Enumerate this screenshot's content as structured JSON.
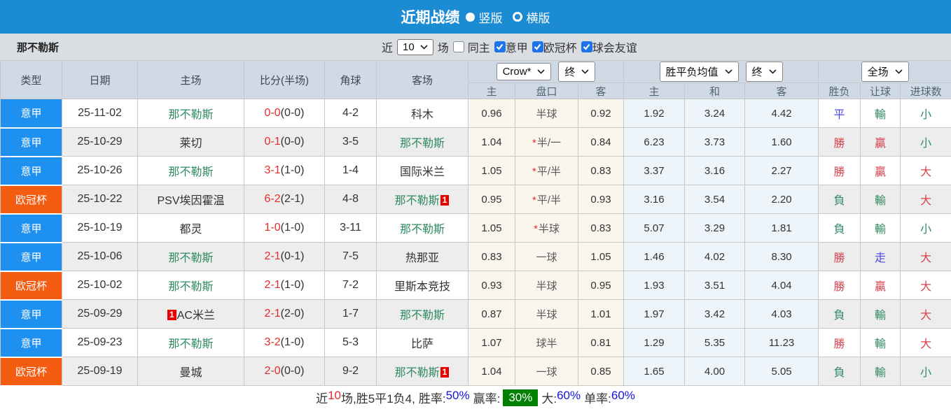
{
  "topbar": {
    "title": "近期战绩",
    "vertical_label": "竖版",
    "horizontal_label": "横版"
  },
  "filter": {
    "team": "那不勒斯",
    "near_label": "近",
    "count_value": "10",
    "games_label": "场",
    "same_home_label": "同主",
    "leagues": [
      "意甲",
      "欧冠杯",
      "球会友谊"
    ]
  },
  "table": {
    "left_headers": [
      "类型",
      "日期",
      "主场",
      "比分(半场)",
      "角球",
      "客场"
    ],
    "sub_headers": [
      "主",
      "盘口",
      "客",
      "主",
      "和",
      "客",
      "胜负",
      "让球",
      "进球数"
    ],
    "dropdowns": {
      "company": "Crow*",
      "time1": "终",
      "avg": "胜平负均值",
      "time2": "终",
      "scope": "全场"
    },
    "rows": [
      {
        "league": "意甲",
        "date": "25-11-02",
        "home": {
          "name": "那不勒斯",
          "subject": true
        },
        "away": {
          "name": "科木",
          "subject": false
        },
        "score": "0-0",
        "half": "(0-0)",
        "corners": "4-2",
        "odds": {
          "home": "0.96",
          "star": false,
          "handicap": "半球",
          "away": "0.92"
        },
        "avg": {
          "home": "1.92",
          "draw": "3.24",
          "away": "4.42"
        },
        "wdl": {
          "t": "平",
          "c": "draw"
        },
        "handicap": {
          "t": "輸",
          "c": "loss"
        },
        "goals": {
          "t": "小",
          "c": "loss"
        }
      },
      {
        "league": "意甲",
        "date": "25-10-29",
        "home": {
          "name": "莱切",
          "subject": false
        },
        "away": {
          "name": "那不勒斯",
          "subject": true
        },
        "score": "0-1",
        "half": "(0-0)",
        "corners": "3-5",
        "odds": {
          "home": "1.04",
          "star": true,
          "handicap": "半/一",
          "away": "0.84"
        },
        "avg": {
          "home": "6.23",
          "draw": "3.73",
          "away": "1.60"
        },
        "wdl": {
          "t": "勝",
          "c": "win"
        },
        "handicap": {
          "t": "贏",
          "c": "win"
        },
        "goals": {
          "t": "小",
          "c": "loss"
        }
      },
      {
        "league": "意甲",
        "date": "25-10-26",
        "home": {
          "name": "那不勒斯",
          "subject": true
        },
        "away": {
          "name": "国际米兰",
          "subject": false
        },
        "score": "3-1",
        "half": "(1-0)",
        "corners": "1-4",
        "odds": {
          "home": "1.05",
          "star": true,
          "handicap": "平/半",
          "away": "0.83"
        },
        "avg": {
          "home": "3.37",
          "draw": "3.16",
          "away": "2.27"
        },
        "wdl": {
          "t": "勝",
          "c": "win"
        },
        "handicap": {
          "t": "贏",
          "c": "win"
        },
        "goals": {
          "t": "大",
          "c": "win"
        }
      },
      {
        "league": "欧冠杯",
        "date": "25-10-22",
        "home": {
          "name": "PSV埃因霍温",
          "subject": false
        },
        "away": {
          "name": "那不勒斯",
          "subject": true,
          "card": "1",
          "card_pos": "after"
        },
        "score": "6-2",
        "half": "(2-1)",
        "corners": "4-8",
        "odds": {
          "home": "0.95",
          "star": true,
          "handicap": "平/半",
          "away": "0.93"
        },
        "avg": {
          "home": "3.16",
          "draw": "3.54",
          "away": "2.20"
        },
        "wdl": {
          "t": "負",
          "c": "loss"
        },
        "handicap": {
          "t": "輸",
          "c": "loss"
        },
        "goals": {
          "t": "大",
          "c": "win"
        }
      },
      {
        "league": "意甲",
        "date": "25-10-19",
        "home": {
          "name": "都灵",
          "subject": false
        },
        "away": {
          "name": "那不勒斯",
          "subject": true
        },
        "score": "1-0",
        "half": "(1-0)",
        "corners": "3-11",
        "odds": {
          "home": "1.05",
          "star": true,
          "handicap": "半球",
          "away": "0.83"
        },
        "avg": {
          "home": "5.07",
          "draw": "3.29",
          "away": "1.81"
        },
        "wdl": {
          "t": "負",
          "c": "loss"
        },
        "handicap": {
          "t": "輸",
          "c": "loss"
        },
        "goals": {
          "t": "小",
          "c": "loss"
        }
      },
      {
        "league": "意甲",
        "date": "25-10-06",
        "home": {
          "name": "那不勒斯",
          "subject": true
        },
        "away": {
          "name": "热那亚",
          "subject": false
        },
        "score": "2-1",
        "half": "(0-1)",
        "corners": "7-5",
        "odds": {
          "home": "0.83",
          "star": false,
          "handicap": "一球",
          "away": "1.05"
        },
        "avg": {
          "home": "1.46",
          "draw": "4.02",
          "away": "8.30"
        },
        "wdl": {
          "t": "勝",
          "c": "win"
        },
        "handicap": {
          "t": "走",
          "c": "draw"
        },
        "goals": {
          "t": "大",
          "c": "win"
        }
      },
      {
        "league": "欧冠杯",
        "date": "25-10-02",
        "home": {
          "name": "那不勒斯",
          "subject": true
        },
        "away": {
          "name": "里斯本竞技",
          "subject": false
        },
        "score": "2-1",
        "half": "(1-0)",
        "corners": "7-2",
        "odds": {
          "home": "0.93",
          "star": false,
          "handicap": "半球",
          "away": "0.95"
        },
        "avg": {
          "home": "1.93",
          "draw": "3.51",
          "away": "4.04"
        },
        "wdl": {
          "t": "勝",
          "c": "win"
        },
        "handicap": {
          "t": "贏",
          "c": "win"
        },
        "goals": {
          "t": "大",
          "c": "win"
        }
      },
      {
        "league": "意甲",
        "date": "25-09-29",
        "home": {
          "name": "AC米兰",
          "subject": false,
          "card": "1",
          "card_pos": "before"
        },
        "away": {
          "name": "那不勒斯",
          "subject": true
        },
        "score": "2-1",
        "half": "(2-0)",
        "corners": "1-7",
        "odds": {
          "home": "0.87",
          "star": false,
          "handicap": "半球",
          "away": "1.01"
        },
        "avg": {
          "home": "1.97",
          "draw": "3.42",
          "away": "4.03"
        },
        "wdl": {
          "t": "負",
          "c": "loss"
        },
        "handicap": {
          "t": "輸",
          "c": "loss"
        },
        "goals": {
          "t": "大",
          "c": "win"
        }
      },
      {
        "league": "意甲",
        "date": "25-09-23",
        "home": {
          "name": "那不勒斯",
          "subject": true
        },
        "away": {
          "name": "比萨",
          "subject": false
        },
        "score": "3-2",
        "half": "(1-0)",
        "corners": "5-3",
        "odds": {
          "home": "1.07",
          "star": false,
          "handicap": "球半",
          "away": "0.81"
        },
        "avg": {
          "home": "1.29",
          "draw": "5.35",
          "away": "11.23"
        },
        "wdl": {
          "t": "勝",
          "c": "win"
        },
        "handicap": {
          "t": "輸",
          "c": "loss"
        },
        "goals": {
          "t": "大",
          "c": "win"
        }
      },
      {
        "league": "欧冠杯",
        "date": "25-09-19",
        "home": {
          "name": "曼城",
          "subject": false
        },
        "away": {
          "name": "那不勒斯",
          "subject": true,
          "card": "1",
          "card_pos": "after"
        },
        "score": "2-0",
        "half": "(0-0)",
        "corners": "9-2",
        "odds": {
          "home": "1.04",
          "star": false,
          "handicap": "一球",
          "away": "0.85"
        },
        "avg": {
          "home": "1.65",
          "draw": "4.00",
          "away": "5.05"
        },
        "wdl": {
          "t": "負",
          "c": "loss"
        },
        "handicap": {
          "t": "輸",
          "c": "loss"
        },
        "goals": {
          "t": "小",
          "c": "loss"
        }
      }
    ]
  },
  "league_colors": {
    "意甲": "#1e90f0",
    "欧冠杯": "#f45c12"
  },
  "footer": {
    "near": "近",
    "count": "10",
    "record": "场,胜5平1负4,",
    "rate_label": "胜率:",
    "rate_value": "50%",
    "win_label": "赢率:",
    "win_value": "30%",
    "big_label": "大:",
    "big_value": "60%",
    "single_label": "单率:",
    "single_value": "60%"
  }
}
